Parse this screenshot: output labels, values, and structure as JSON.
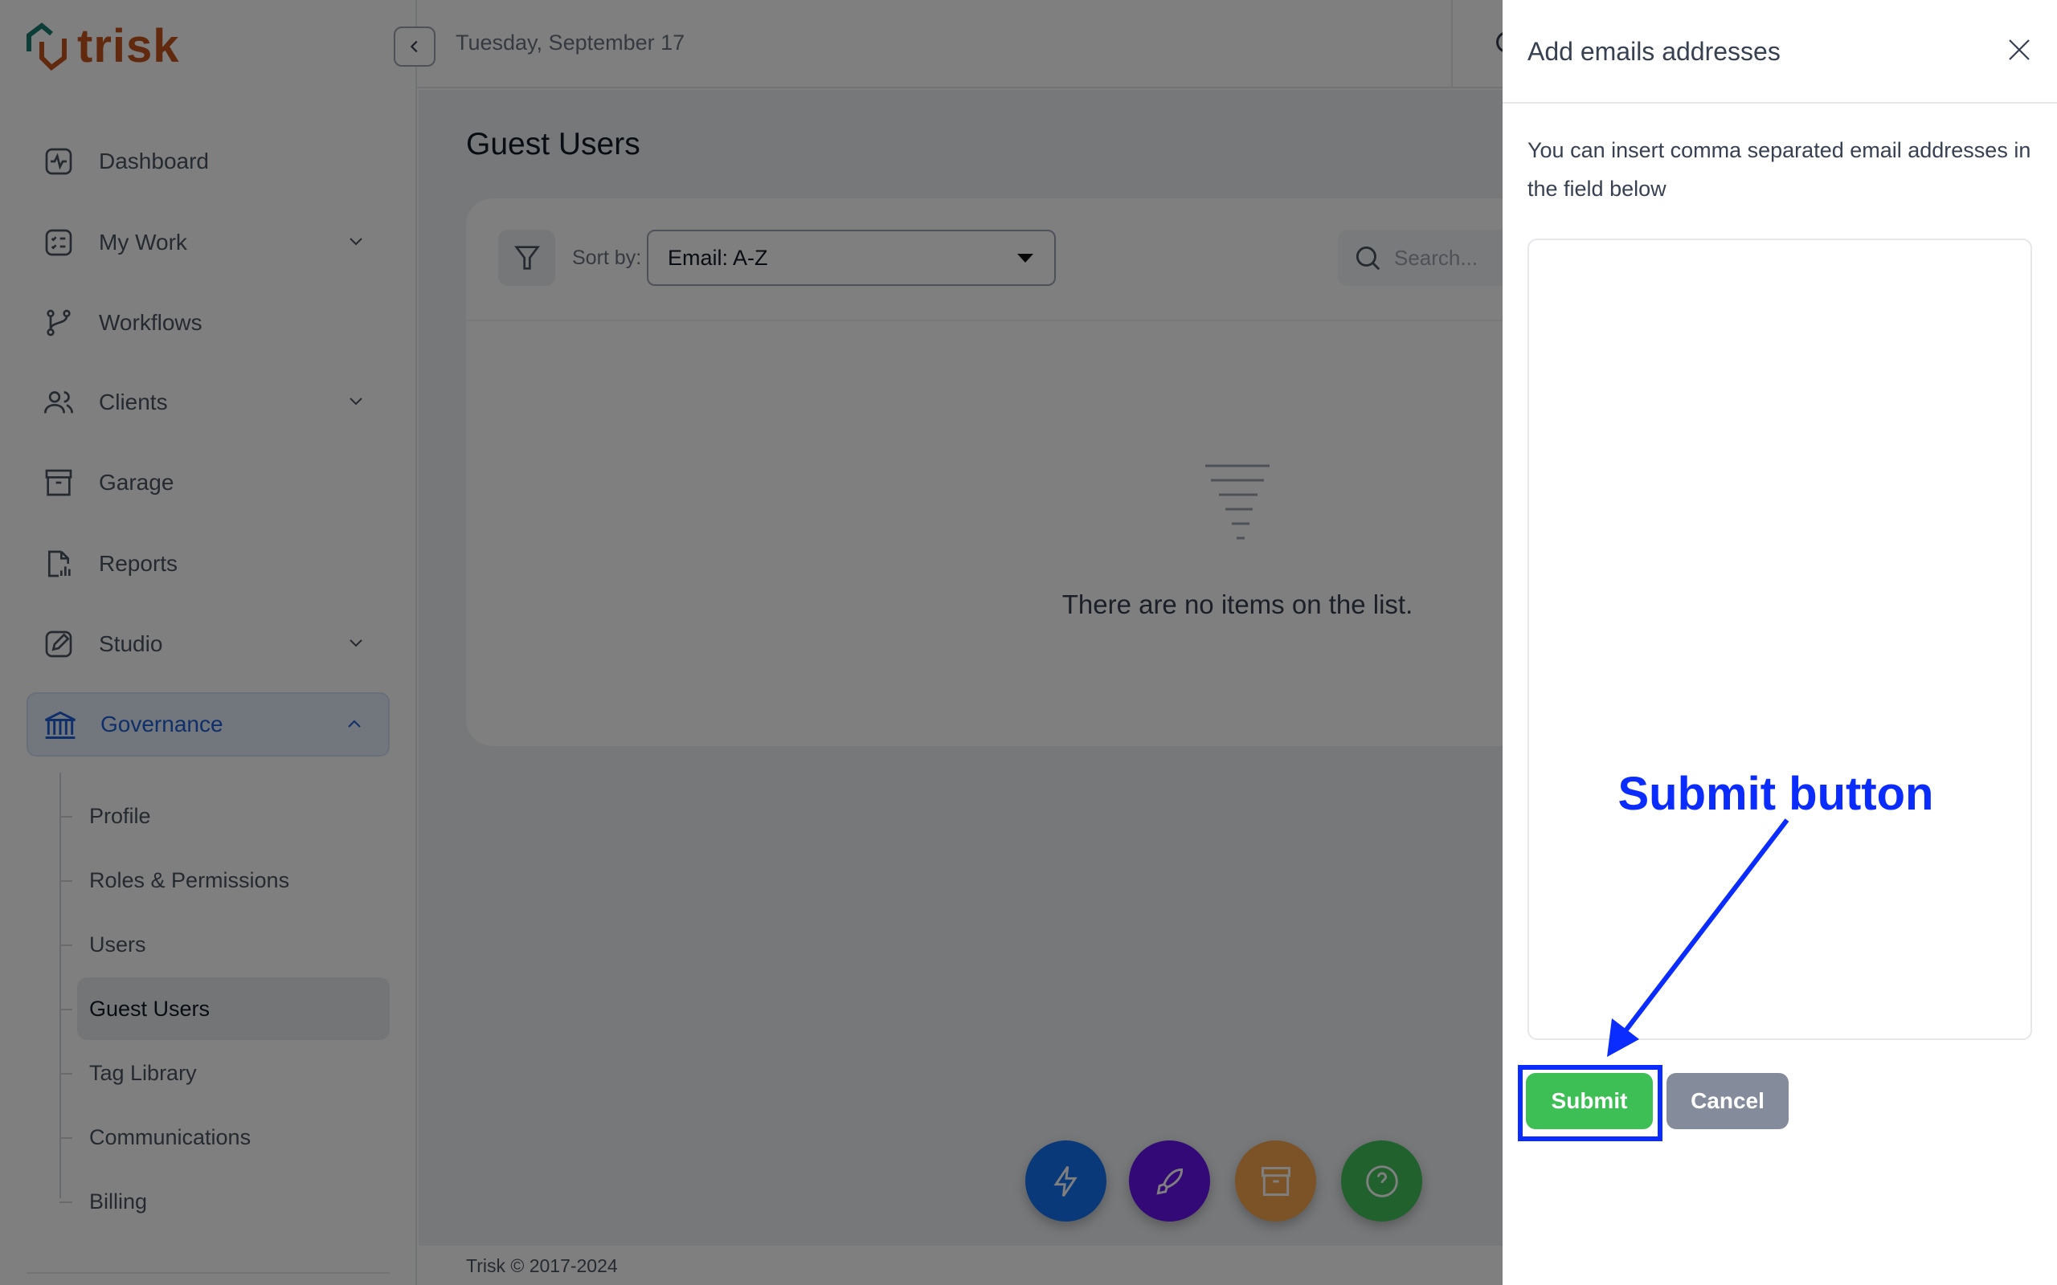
{
  "app": {
    "brand": "trisk",
    "date": "Tuesday, September 17"
  },
  "sidebar": {
    "items": [
      {
        "label": "Dashboard",
        "icon": "activity-icon",
        "chevron": false
      },
      {
        "label": "My Work",
        "icon": "checklist-icon",
        "chevron": true
      },
      {
        "label": "Workflows",
        "icon": "git-branch-icon",
        "chevron": false
      },
      {
        "label": "Clients",
        "icon": "users-icon",
        "chevron": true
      },
      {
        "label": "Garage",
        "icon": "archive-icon",
        "chevron": false
      },
      {
        "label": "Reports",
        "icon": "report-icon",
        "chevron": false
      },
      {
        "label": "Studio",
        "icon": "edit-icon",
        "chevron": true
      },
      {
        "label": "Governance",
        "icon": "bank-icon",
        "chevron": true,
        "expanded": true,
        "active": true
      }
    ],
    "sub_items": [
      "Profile",
      "Roles & Permissions",
      "Users",
      "Guest Users",
      "Tag Library",
      "Communications",
      "Billing"
    ],
    "active_sub": "Guest Users"
  },
  "main": {
    "title": "Guest Users",
    "sort_label": "Sort by:",
    "sort_value": "Email: A-Z",
    "search_placeholder": "Search...",
    "empty_text": "There are no items on the list.",
    "footer": "Trisk © 2017-2024"
  },
  "fabs": [
    {
      "icon": "lightning-icon",
      "color": "#1572f5"
    },
    {
      "icon": "rocket-icon",
      "color": "#6412ee"
    },
    {
      "icon": "archive-icon",
      "color": "#f6a74c"
    },
    {
      "icon": "help-icon",
      "color": "#41c25a"
    }
  ],
  "drawer": {
    "title": "Add emails addresses",
    "description": "You can insert comma separated email addresses in the field below",
    "textarea_value": "",
    "submit": "Submit",
    "cancel": "Cancel"
  },
  "annotation": {
    "text": "Submit button",
    "color": "#0a2cff"
  },
  "colors": {
    "accent": "#1c5fd4",
    "submit": "#3dbf55",
    "cancel": "#848b9b",
    "brand": "#c2551f"
  }
}
